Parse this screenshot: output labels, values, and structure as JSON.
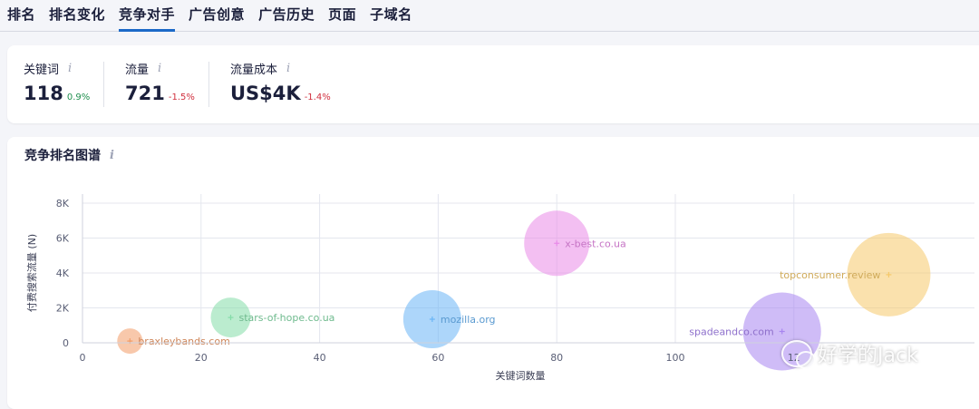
{
  "tabs": [
    {
      "label": "排名"
    },
    {
      "label": "排名变化"
    },
    {
      "label": "竞争对手",
      "active": true
    },
    {
      "label": "广告创意"
    },
    {
      "label": "广告历史"
    },
    {
      "label": "页面"
    },
    {
      "label": "子域名"
    }
  ],
  "metrics": [
    {
      "label": "关键词",
      "value": "118",
      "delta": "0.9%",
      "trend": "up"
    },
    {
      "label": "流量",
      "value": "721",
      "delta": "-1.5%",
      "trend": "down"
    },
    {
      "label": "流量成本",
      "value": "US$4K",
      "delta": "-1.4%",
      "trend": "down"
    }
  ],
  "info_icon_glyph": "i",
  "chart_section": {
    "title": "竞争排名图谱"
  },
  "chart_data": {
    "type": "scatter",
    "title": "竞争排名图谱",
    "xlabel": "关键词数量",
    "ylabel": "付费搜索流量 (N)",
    "xlim": [
      0,
      140
    ],
    "ylim": [
      0,
      8000
    ],
    "x_ticks": [
      0,
      20,
      40,
      60,
      80,
      100,
      120
    ],
    "x_tick_labels": [
      "0",
      "20",
      "40",
      "60",
      "80",
      "100",
      "12"
    ],
    "y_ticks": [
      0,
      2000,
      4000,
      6000,
      8000
    ],
    "y_tick_labels": [
      "0",
      "2K",
      "4K",
      "6K",
      "8K"
    ],
    "grid": true,
    "points": [
      {
        "name": "braxleybands.com",
        "x": 8,
        "y": 100,
        "r": 14,
        "color": "#f29b66",
        "label_side": "right"
      },
      {
        "name": "stars-of-hope.co.ua",
        "x": 25,
        "y": 1450,
        "r": 22,
        "color": "#84dca8",
        "label_side": "right"
      },
      {
        "name": "mozilla.org",
        "x": 59,
        "y": 1350,
        "r": 32,
        "color": "#6ab5f5",
        "label_side": "right"
      },
      {
        "name": "x-best.co.ua",
        "x": 80,
        "y": 5700,
        "r": 36,
        "color": "#e98ae8",
        "label_side": "right"
      },
      {
        "name": "spadeandco.com",
        "x": 118,
        "y": 650,
        "r": 43,
        "color": "#a885f0",
        "label_side": "left"
      },
      {
        "name": "topconsumer.review",
        "x": 136,
        "y": 3900,
        "r": 46,
        "color": "#f5c96a",
        "label_side": "left"
      }
    ]
  },
  "watermark": {
    "text": "好学的Jack"
  }
}
